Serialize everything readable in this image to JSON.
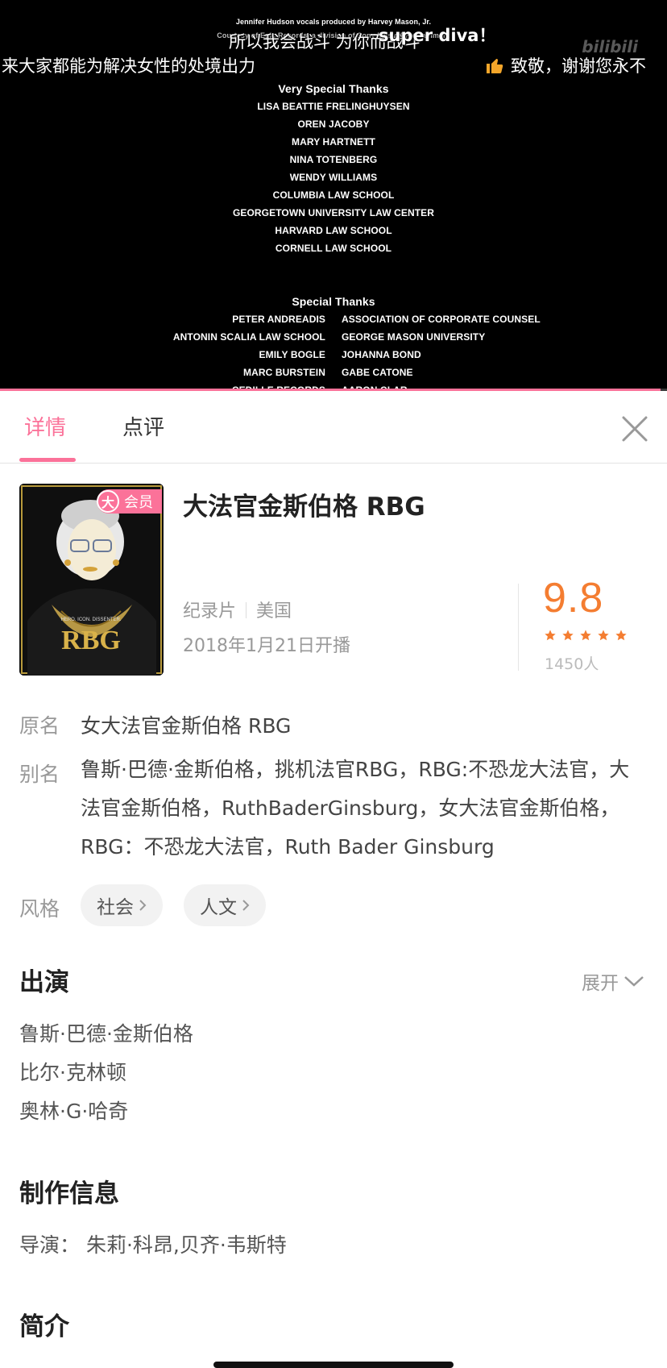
{
  "video": {
    "credits_top_small_1": "Jennifer Hudson vocals produced by Harvey Mason, Jr.",
    "credits_top_small_2": "Courtesy of Epic Records, a division of Sony Music Entertainment",
    "very_special_heading": "Very Special Thanks",
    "very_special": [
      "LISA BEATTIE FRELINGHUYSEN",
      "OREN JACOBY",
      "MARY HARTNETT",
      "NINA TOTENBERG",
      "WENDY WILLIAMS",
      "COLUMBIA LAW SCHOOL",
      "GEORGETOWN UNIVERSITY LAW CENTER",
      "HARVARD LAW SCHOOL",
      "CORNELL LAW SCHOOL"
    ],
    "special_heading": "Special Thanks",
    "special_pairs": [
      [
        "PETER ANDREADIS",
        "ASSOCIATION OF CORPORATE COUNSEL"
      ],
      [
        "ANTONIN SCALIA LAW SCHOOL",
        "GEORGE MASON UNIVERSITY"
      ],
      [
        "EMILY BOGLE",
        "JOHANNA BOND"
      ],
      [
        "MARC BURSTEIN",
        "GABE CATONE"
      ],
      [
        "CEDILLE RECORDS",
        "AARON CLAR"
      ]
    ],
    "danmaku": [
      "所以我会战斗 为你而战斗",
      "super diva！",
      "来大家都能为解决女性的处境出力",
      "致敬，谢谢您永不"
    ],
    "watermark": "bilibili",
    "progress": 0.99,
    "accent": "#fb7299"
  },
  "tabs": {
    "detail": "详情",
    "review": "点评"
  },
  "header": {
    "title": "大法官金斯伯格 RBG",
    "vip_icon_char": "大",
    "vip_label": "会员",
    "genre": "纪录片",
    "region": "美国",
    "release": "2018年1月21日开播",
    "score": "9.8",
    "stars": 5,
    "score_count": "1450人",
    "score_color": "#f47d31"
  },
  "poster": {
    "tagline": "HERO. ICON. DISSENTER.",
    "logo": "RBG"
  },
  "details": {
    "original_label": "原名",
    "original_value": "女大法官金斯伯格 RBG",
    "alias_label": "别名",
    "alias_value": "鲁斯·巴德·金斯伯格，挑机法官RBG，RBG:不恐龙大法官，大法官金斯伯格，RuthBaderGinsburg，女大法官金斯伯格，RBG：不恐龙大法官，Ruth Bader Ginsburg",
    "style_label": "风格",
    "tags": [
      "社会",
      "人文"
    ]
  },
  "cast": {
    "title": "出演",
    "expand": "展开",
    "items": [
      "鲁斯·巴德·金斯伯格",
      "比尔·克林顿",
      "奥林·G·哈奇"
    ]
  },
  "production": {
    "title": "制作信息",
    "director": "导演：  朱莉·科昂,贝齐·韦斯特"
  },
  "intro": {
    "title": "简介"
  }
}
